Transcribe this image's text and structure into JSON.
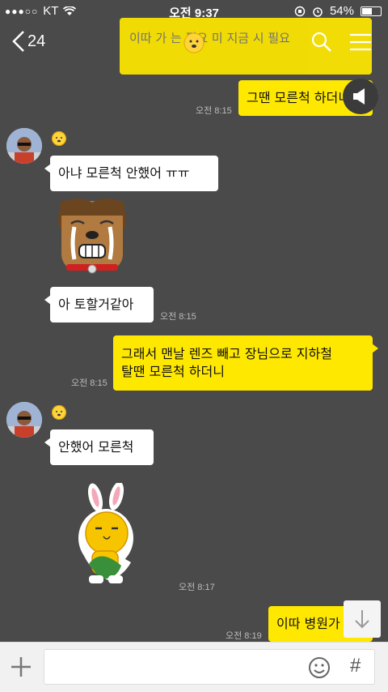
{
  "status_bar": {
    "carrier": "KT",
    "time": "오전 9:37",
    "battery": "54%",
    "battery_level": 0.54
  },
  "header": {
    "back_count": "24"
  },
  "notice": {
    "text": "이따 가 는 필요 미 지금 시 필요"
  },
  "messages": [
    {
      "sender": "me",
      "text": "그땐 모른척 하더니",
      "time": "오전 8:15"
    },
    {
      "sender": "other",
      "text": "아냐 모른척 안했어 ㅠㅠ"
    },
    {
      "sender": "other",
      "text": "아 토할거같아",
      "time": "오전 8:15"
    },
    {
      "sender": "me",
      "text": "그래서 맨날 렌즈 빼고 장님으로 지하철",
      "text2": "탈땐 모른척 하더니",
      "time": "오전 8:15"
    },
    {
      "sender": "other",
      "text": "안했어 모른척"
    },
    {
      "sender": "other",
      "sticker": "rabbit",
      "time": "오전 8:17"
    },
    {
      "sender": "me",
      "text": "이따 병원가",
      "time": "오전 8:19"
    }
  ],
  "colors": {
    "background": "#4a4a4a",
    "my_bubble": "#ffe800",
    "other_bubble": "#ffffff"
  }
}
